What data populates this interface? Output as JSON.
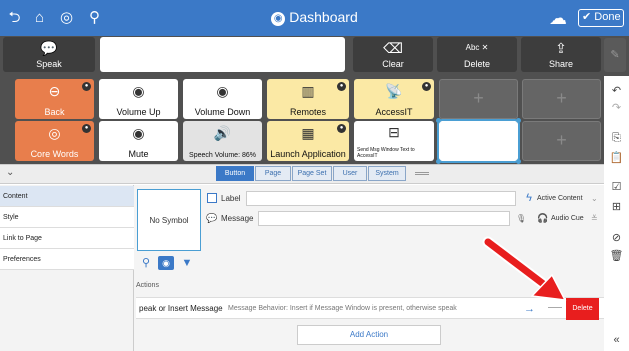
{
  "app": {
    "title": "Dashboard",
    "done_label": "Done"
  },
  "toolbar": {
    "speak_label": "Speak",
    "clear_label": "Clear",
    "delete_label": "Delete",
    "share_label": "Share",
    "delete_icon_text": "Abc"
  },
  "grid": {
    "row1": [
      {
        "label": "Back",
        "style": "orange",
        "icon": "back-arrow-icon"
      },
      {
        "label": "Volume Up",
        "style": "white",
        "icon": "speaker-up-icon"
      },
      {
        "label": "Volume Down",
        "style": "white",
        "icon": "speaker-down-icon"
      },
      {
        "label": "Remotes",
        "style": "yellow",
        "icon": "remote-icon"
      },
      {
        "label": "AccessIT",
        "style": "yellow",
        "icon": "broadcast-icon"
      }
    ],
    "row2": [
      {
        "label": "Core Words",
        "style": "orange",
        "icon": "target-icon"
      },
      {
        "label": "Mute",
        "style": "white",
        "icon": "mute-icon"
      },
      {
        "label": "Speech Volume: 86%",
        "style": "grey",
        "icon": "speech-volume-icon"
      },
      {
        "label": "Launch Application",
        "style": "yellow",
        "icon": "apps-icon"
      },
      {
        "label": "Send Msg Window Text to AccessIT",
        "style": "white",
        "icon": "send-message-icon"
      }
    ]
  },
  "tabs": [
    "Button",
    "Page",
    "Page Set",
    "User",
    "System"
  ],
  "left_panel": [
    "Content",
    "Style",
    "Link to Page",
    "Preferences"
  ],
  "editor": {
    "no_symbol": "No Symbol",
    "label_field": "Label",
    "message_field": "Message",
    "active_content": "Active Content",
    "audio_cue": "Audio Cue",
    "actions_header": "Actions",
    "action_name": "peak or Insert Message",
    "action_desc": "Message Behavior: Insert if Message Window is present, otherwise speak",
    "delete_label": "Delete",
    "add_action_label": "Add Action"
  },
  "colors": {
    "top_bar": "#3b79c7",
    "accent_orange": "#e87e4c",
    "delete_red": "#e81e1e",
    "yellow_cell": "#fbe9a5"
  }
}
